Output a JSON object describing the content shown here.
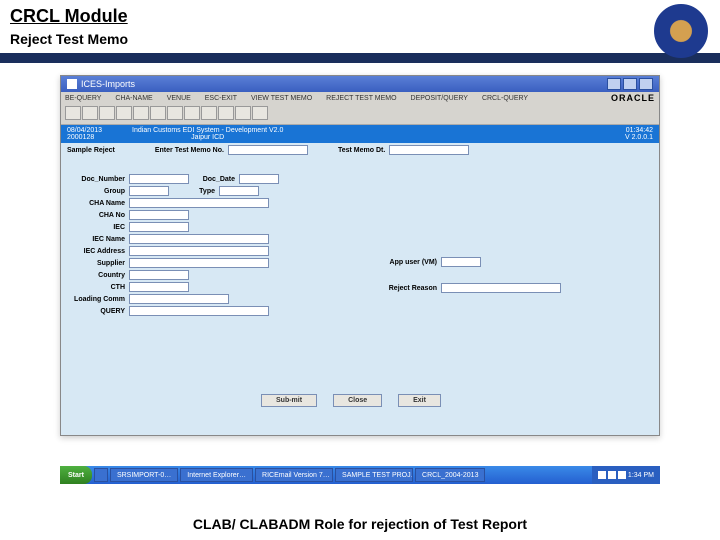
{
  "header": {
    "title": "CRCL Module",
    "subtitle": "Reject Test Memo"
  },
  "window": {
    "title": "ICES-Imports",
    "menubar": [
      "BE-QUERY",
      "CHA-NAME",
      "VENUE",
      "ESC-EXIT",
      "VIEW TEST MEMO",
      "REJECT TEST MEMO",
      "DEPOSIT/QUERY",
      "CRCL-QUERY"
    ],
    "brand": "ORACLE",
    "status": {
      "date": "08/04/2013",
      "code": "2000128",
      "system": "Indian Customs EDI System - Development V2.0",
      "location": "Jaipur ICD",
      "time": "01:34:42",
      "version": "V 2.0.0.1"
    },
    "form": {
      "section_title": "Sample Reject",
      "entry1": "Enter Test Memo No.",
      "entry2": "Test Memo Dt.",
      "left_labels": [
        "Doc_Number",
        "Group",
        "CHA Name",
        "CHA No",
        "IEC",
        "IEC Name",
        "IEC Address",
        "Supplier",
        "Country",
        "CTH",
        "Loading Comm",
        "QUERY"
      ],
      "left_labels2": {
        "doc_date": "Doc_Date",
        "type": "Type"
      },
      "right": {
        "approver": "App user (VM)",
        "reason": "Reject Reason"
      },
      "buttons": {
        "submit": "Sub-mit",
        "close": "Close",
        "exit": "Exit"
      }
    }
  },
  "taskbar": {
    "start": "Start",
    "items": [
      "",
      "SRSIMPORT-0…",
      "Internet Explorer…",
      "RICEmail Version 7…",
      "SAMPLE TEST PROJ…",
      "CRCL_2004-2013"
    ],
    "clock": "1:34 PM"
  },
  "caption": "CLAB/ CLABADM Role for rejection of  Test Report"
}
